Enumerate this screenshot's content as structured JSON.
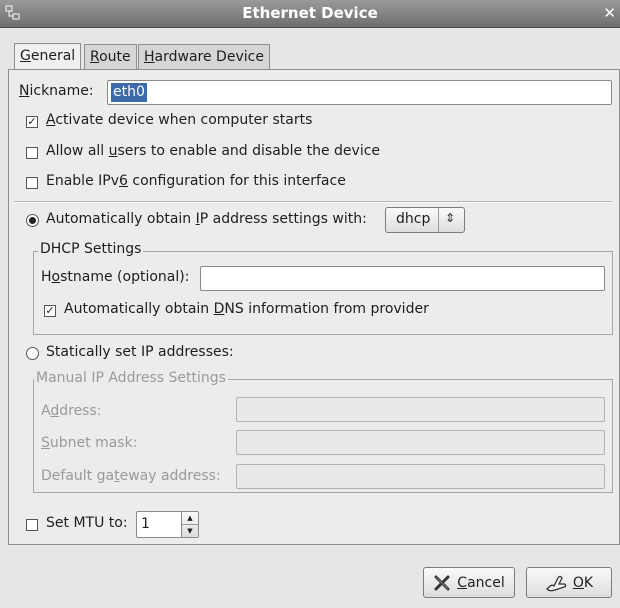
{
  "window": {
    "title": "Ethernet Device",
    "close_glyph": "✕"
  },
  "tabs": [
    {
      "pre": "",
      "mn": "G",
      "post": "eneral"
    },
    {
      "pre": "",
      "mn": "R",
      "post": "oute"
    },
    {
      "pre": "",
      "mn": "H",
      "post": "ardware Device"
    }
  ],
  "nickname": {
    "pre": "",
    "mn": "N",
    "post": "ickname:",
    "value": "eth0"
  },
  "checks": [
    {
      "pre": "",
      "mn": "A",
      "post": "ctivate device when computer starts",
      "checked": true
    },
    {
      "pre": "Allow all ",
      "mn": "u",
      "post": "sers to enable and disable the device",
      "checked": false
    },
    {
      "pre": "Enable IPv",
      "mn": "6",
      "post": " configuration for this interface",
      "checked": false
    }
  ],
  "auto_ip": {
    "pre": "Automatically obtain ",
    "mn": "I",
    "post": "P address settings with:",
    "selected": true,
    "combo_value": "dhcp",
    "combo_arrow": "⇕"
  },
  "dhcp": {
    "title": "DHCP Settings",
    "hostname": {
      "pre": "H",
      "mn": "o",
      "post": "stname (optional):",
      "value": ""
    },
    "dns": {
      "pre": "Automatically obtain ",
      "mn": "D",
      "post": "NS information from provider",
      "checked": true
    }
  },
  "static_ip": {
    "label": "Statically set IP addresses:",
    "selected": false
  },
  "manual": {
    "title": "Manual IP Address Settings",
    "address": {
      "pre": "A",
      "mn": "d",
      "post": "dress:"
    },
    "subnet": {
      "pre": "",
      "mn": "S",
      "post": "ubnet mask:"
    },
    "gateway": {
      "pre": "Default ga",
      "mn": "t",
      "post": "eway address:"
    }
  },
  "mtu": {
    "label": "Set MTU to:",
    "value": "1",
    "checked": false,
    "up": "▲",
    "down": "▼"
  },
  "buttons": {
    "cancel": {
      "pre": "",
      "mn": "C",
      "post": "ancel"
    },
    "ok": {
      "pre": "",
      "mn": "O",
      "post": "K"
    }
  },
  "check_glyph": "✓",
  "icons": [
    "window-icon",
    "close-icon",
    "combo-arrow-icon",
    "spin-up-icon",
    "spin-down-icon",
    "cancel-icon",
    "ok-icon"
  ]
}
